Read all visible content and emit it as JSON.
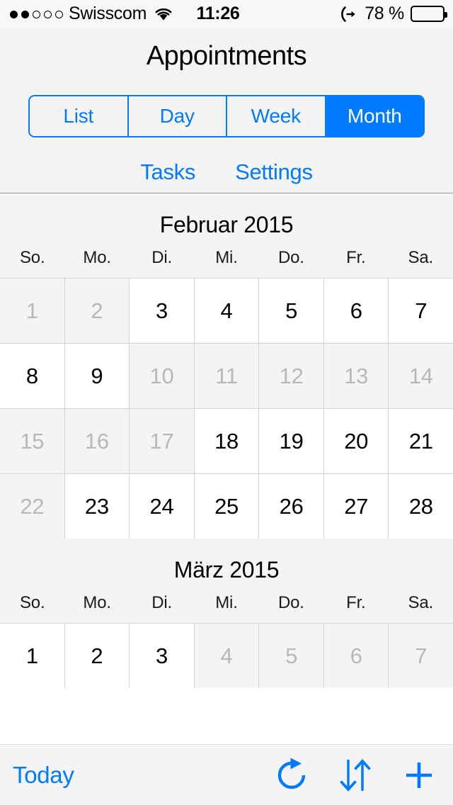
{
  "status_bar": {
    "signal_dots_total": 5,
    "signal_dots_filled": 2,
    "carrier": "Swisscom",
    "wifi_icon": "wifi-icon",
    "time": "11:26",
    "location_icon": "location-arrow-icon",
    "battery_percent_label": "78 %",
    "battery_level": 78
  },
  "header": {
    "title": "Appointments"
  },
  "segmented_control": {
    "selected_index": 3,
    "segments": [
      {
        "label": "List"
      },
      {
        "label": "Day"
      },
      {
        "label": "Week"
      },
      {
        "label": "Month"
      }
    ]
  },
  "nav_links": [
    {
      "label": "Tasks"
    },
    {
      "label": "Settings"
    }
  ],
  "calendar": {
    "weekdays": [
      "So.",
      "Mo.",
      "Di.",
      "Mi.",
      "Do.",
      "Fr.",
      "Sa."
    ],
    "months": [
      {
        "title": "Februar 2015",
        "weeks": [
          [
            {
              "day": "1",
              "dim": true
            },
            {
              "day": "2",
              "dim": true
            },
            {
              "day": "3",
              "dim": false
            },
            {
              "day": "4",
              "dim": false
            },
            {
              "day": "5",
              "dim": false
            },
            {
              "day": "6",
              "dim": false
            },
            {
              "day": "7",
              "dim": false
            }
          ],
          [
            {
              "day": "8",
              "dim": false
            },
            {
              "day": "9",
              "dim": false
            },
            {
              "day": "10",
              "dim": true
            },
            {
              "day": "11",
              "dim": true
            },
            {
              "day": "12",
              "dim": true
            },
            {
              "day": "13",
              "dim": true
            },
            {
              "day": "14",
              "dim": true
            }
          ],
          [
            {
              "day": "15",
              "dim": true
            },
            {
              "day": "16",
              "dim": true
            },
            {
              "day": "17",
              "dim": true
            },
            {
              "day": "18",
              "dim": false
            },
            {
              "day": "19",
              "dim": false
            },
            {
              "day": "20",
              "dim": false
            },
            {
              "day": "21",
              "dim": false
            }
          ],
          [
            {
              "day": "22",
              "dim": true
            },
            {
              "day": "23",
              "dim": false
            },
            {
              "day": "24",
              "dim": false
            },
            {
              "day": "25",
              "dim": false
            },
            {
              "day": "26",
              "dim": false
            },
            {
              "day": "27",
              "dim": false
            },
            {
              "day": "28",
              "dim": false
            }
          ]
        ]
      },
      {
        "title": "März 2015",
        "weeks": [
          [
            {
              "day": "1",
              "dim": false
            },
            {
              "day": "2",
              "dim": false
            },
            {
              "day": "3",
              "dim": false
            },
            {
              "day": "4",
              "dim": true
            },
            {
              "day": "5",
              "dim": true
            },
            {
              "day": "6",
              "dim": true
            },
            {
              "day": "7",
              "dim": true
            }
          ]
        ]
      }
    ]
  },
  "toolbar": {
    "today_label": "Today",
    "actions": [
      {
        "icon": "refresh-icon"
      },
      {
        "icon": "sync-arrows-icon"
      },
      {
        "icon": "add-icon"
      }
    ]
  },
  "colors": {
    "accent": "#007aff",
    "chrome_background": "#f4f4f4",
    "dim_text": "#b8b8b8",
    "grid_line": "#d4d4d4"
  }
}
